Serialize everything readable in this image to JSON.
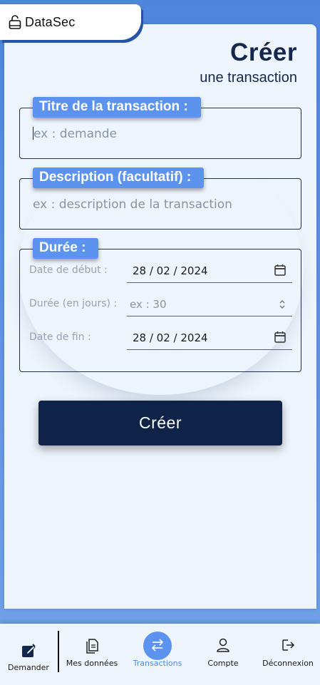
{
  "app": {
    "name": "DataSec"
  },
  "header": {
    "title": "Créer",
    "subtitle": "une transaction"
  },
  "form": {
    "title_field": {
      "legend": "Titre de la transaction :",
      "placeholder": "ex : demande"
    },
    "description_field": {
      "legend": "Description (facultatif) :",
      "placeholder": "ex : description de la transaction"
    },
    "duration_group": {
      "legend": "Durée :",
      "start_date": {
        "label": "Date de début :",
        "value": "28 / 02 / 2024"
      },
      "duration": {
        "label": "Durée (en jours) :",
        "placeholder": "ex : 30"
      },
      "end_date": {
        "label": "Date de fin :",
        "value": "28 / 02 / 2024"
      }
    },
    "submit_label": "Créer"
  },
  "nav": {
    "items": [
      {
        "label": "Demander",
        "icon": "edit-icon",
        "active": false
      },
      {
        "label": "Mes données",
        "icon": "documents-icon",
        "active": false
      },
      {
        "label": "Transactions",
        "icon": "transfer-icon",
        "active": true
      },
      {
        "label": "Compte",
        "icon": "user-icon",
        "active": false
      },
      {
        "label": "Déconnexion",
        "icon": "logout-icon",
        "active": false
      }
    ]
  },
  "colors": {
    "accent": "#5b93ee",
    "primary_dark": "#0e2347",
    "background": "#eef4fc",
    "active_label": "#4f8ae6"
  }
}
